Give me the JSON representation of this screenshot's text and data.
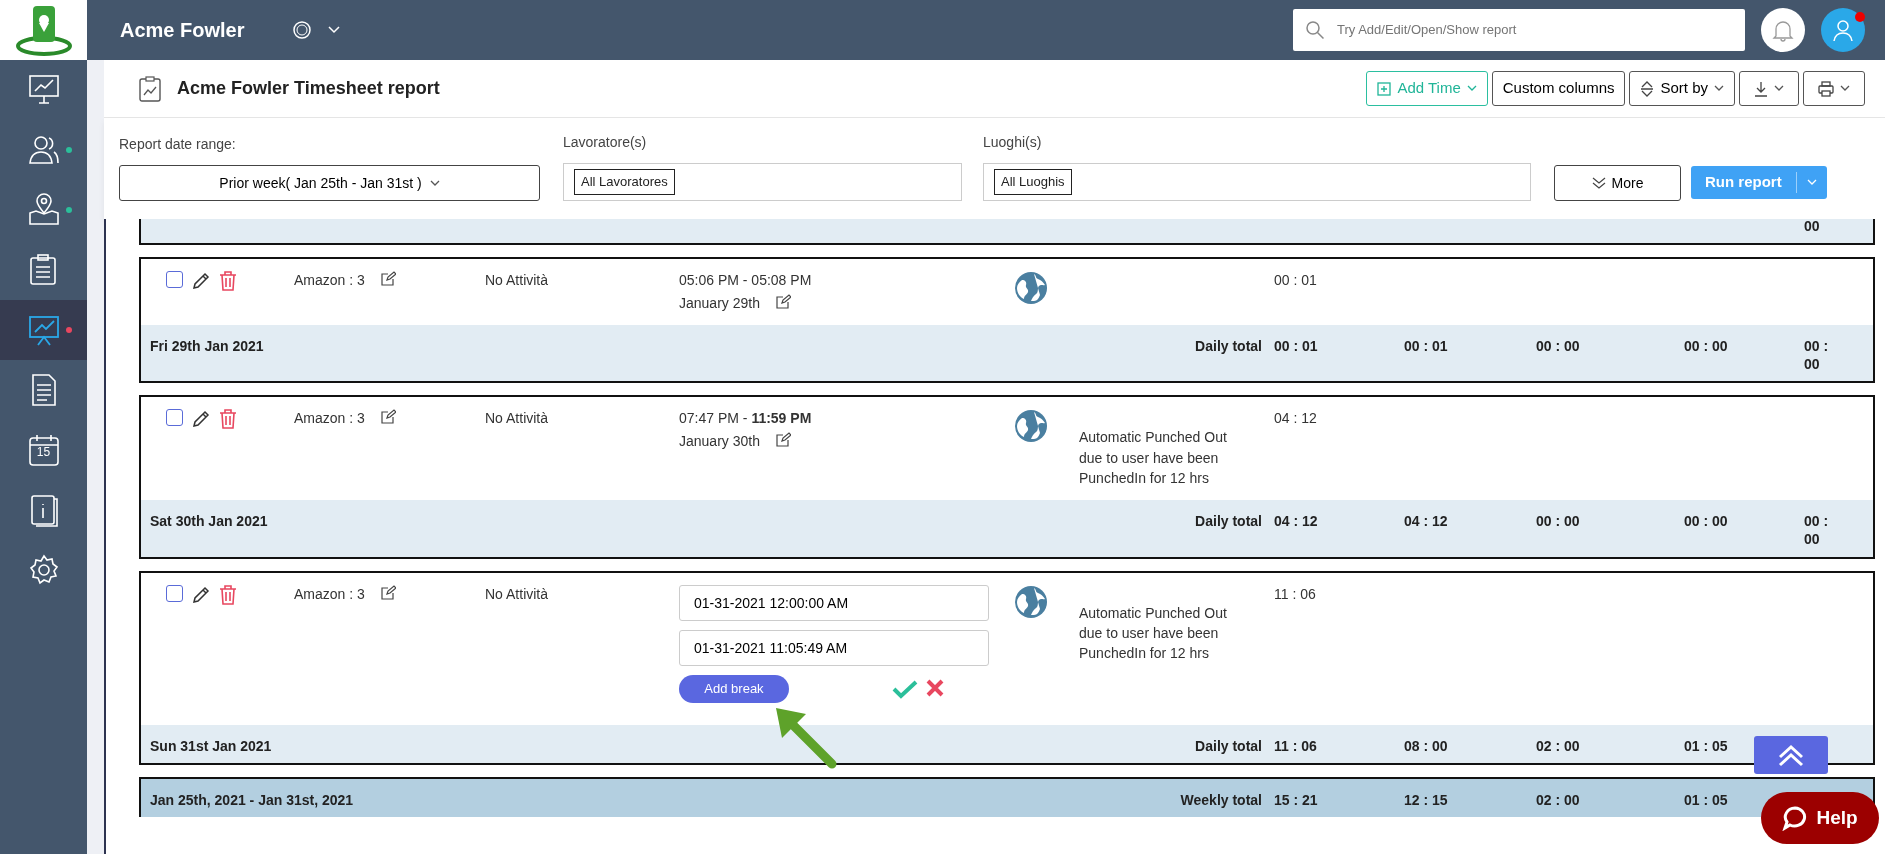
{
  "app": {
    "brand": "Acme Fowler",
    "search": {
      "placeholder": "Try Add/Edit/Open/Show report"
    },
    "notification_dot": true
  },
  "sidebar": {
    "items": [
      {
        "kind": "monitor-chart",
        "selected": false
      },
      {
        "kind": "people",
        "selected": false,
        "color": "#2bbf9a"
      },
      {
        "kind": "map-pin",
        "selected": false,
        "color": "#2bbf9a"
      },
      {
        "kind": "clipboard",
        "selected": false
      },
      {
        "kind": "presentation",
        "selected": true,
        "color": "#e8475f"
      },
      {
        "kind": "document",
        "selected": false
      },
      {
        "kind": "calendar",
        "selected": false,
        "label": "15"
      },
      {
        "kind": "info-book",
        "selected": false
      },
      {
        "kind": "gear",
        "selected": false
      }
    ]
  },
  "report": {
    "title": "Acme Fowler Timesheet report",
    "toolbar": [
      {
        "kind": "add",
        "label": "Add Time"
      },
      {
        "kind": "plain",
        "label": "Custom columns"
      },
      {
        "kind": "sort",
        "label": "Sort by"
      },
      {
        "kind": "download"
      },
      {
        "kind": "print"
      }
    ]
  },
  "filters": {
    "date_range": {
      "label": "Report date range:",
      "value": "Prior week( Jan 25th - Jan 31st )"
    },
    "workers": {
      "label": "Lavoratore(s)",
      "tag": "All Lavoratores"
    },
    "places": {
      "label": "Luoghi(s)",
      "tag": "All Luoghis"
    },
    "more": "More",
    "run": "Run report"
  },
  "days": [
    {
      "kind": "partial",
      "tail": "00"
    },
    {
      "kind": "entry",
      "checked": false,
      "project": "Amazon : 3",
      "activity": "No Attività",
      "time": "05:06 PM - 05:08 PM",
      "date": "January 29th",
      "hours": "00 : 01",
      "footer": {
        "date": "Fri 29th Jan 2021",
        "label": "Daily total",
        "totals": [
          "00 : 01",
          "00 : 01",
          "00 : 00",
          "00 : 00",
          "00 : 00"
        ]
      }
    },
    {
      "kind": "entry",
      "checked": false,
      "project": "Amazon : 3",
      "activity": "No Attività",
      "time": "07:47 PM - **11:59 PM**",
      "date": "January 30th",
      "note": "Automatic Punched Out due to user have been PunchedIn for 12 hrs",
      "hours": "04 : 12",
      "footer": {
        "date": "Sat 30th Jan 2021",
        "label": "Daily total",
        "totals": [
          "04 : 12",
          "04 : 12",
          "00 : 00",
          "00 : 00",
          "00 : 00"
        ]
      }
    },
    {
      "kind": "editing",
      "checked": false,
      "project": "Amazon : 3",
      "activity": "No Attività",
      "start": "01-31-2021 12:00:00 AM",
      "end": "01-31-2021 11:05:49 AM",
      "add_break": "Add break",
      "note": "Automatic Punched Out due to user have been PunchedIn for 12 hrs",
      "hours": "11 : 06",
      "footer": {
        "date": "Sun 31st Jan 2021",
        "label": "Daily total",
        "totals": [
          "11 : 06",
          "08 : 00",
          "02 : 00",
          "01 : 05"
        ]
      }
    }
  ],
  "weekly": {
    "range": "Jan 25th, 2021  -  Jan 31st, 2021",
    "label": "Weekly total",
    "totals": [
      "15 : 21",
      "12 : 15",
      "02 : 00",
      "01 : 05"
    ]
  },
  "help": "Help"
}
